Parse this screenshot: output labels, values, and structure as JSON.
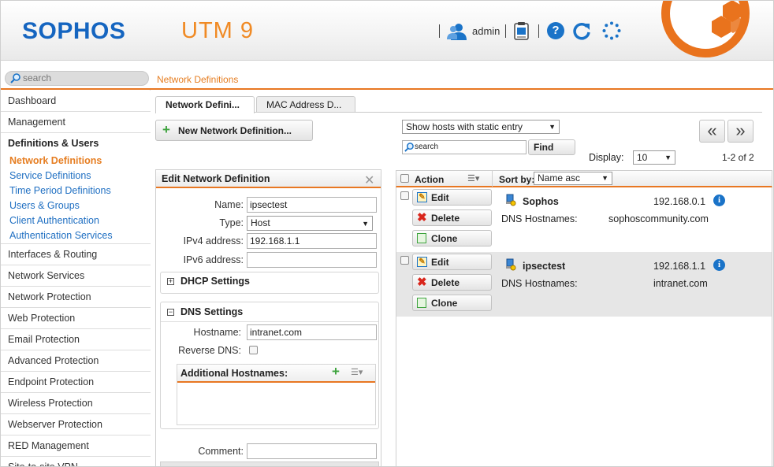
{
  "header": {
    "logo": "SOPHOS",
    "product": "UTM 9",
    "user": "admin"
  },
  "topbar": {
    "search_placeholder": "search",
    "breadcrumb": "Network Definitions"
  },
  "sidebar": {
    "items": [
      {
        "label": "Dashboard"
      },
      {
        "label": "Management"
      },
      {
        "label": "Definitions & Users"
      },
      {
        "label": "Interfaces & Routing"
      },
      {
        "label": "Network Services"
      },
      {
        "label": "Network Protection"
      },
      {
        "label": "Web Protection"
      },
      {
        "label": "Email Protection"
      },
      {
        "label": "Advanced Protection"
      },
      {
        "label": "Endpoint Protection"
      },
      {
        "label": "Wireless Protection"
      },
      {
        "label": "Webserver Protection"
      },
      {
        "label": "RED Management"
      },
      {
        "label": "Site-to-site VPN"
      }
    ],
    "subitems": [
      {
        "label": "Network Definitions"
      },
      {
        "label": "Service Definitions"
      },
      {
        "label": "Time Period Definitions"
      },
      {
        "label": "Users & Groups"
      },
      {
        "label": "Client Authentication"
      },
      {
        "label": "Authentication Services"
      }
    ]
  },
  "tabs": [
    {
      "label": "Network Defini..."
    },
    {
      "label": "MAC Address D..."
    }
  ],
  "toolbar": {
    "new_label": "New Network Definition...",
    "filter_value": "Show hosts with static entry",
    "search_placeholder": "search",
    "find_label": "Find",
    "display_label": "Display:",
    "display_value": "10",
    "count_text": "1-2 of 2",
    "prev": "«",
    "next": "»"
  },
  "edit": {
    "title": "Edit Network Definition",
    "name_label": "Name:",
    "name_value": "ipsectest",
    "type_label": "Type:",
    "type_value": "Host",
    "ipv4_label": "IPv4 address:",
    "ipv4_value": "192.168.1.1",
    "ipv6_label": "IPv6 address:",
    "ipv6_value": "",
    "dhcp_title": "DHCP Settings",
    "dns_title": "DNS Settings",
    "hostname_label": "Hostname:",
    "hostname_value": "intranet.com",
    "reverse_label": "Reverse DNS:",
    "additional_label": "Additional Hostnames:",
    "comment_label": "Comment:",
    "comment_value": ""
  },
  "list": {
    "action_label": "Action",
    "sortby_label": "Sort by:",
    "sort_value": "Name asc",
    "edit_label": "Edit",
    "delete_label": "Delete",
    "clone_label": "Clone",
    "rows": [
      {
        "name": "Sophos",
        "ip": "192.168.0.1",
        "dns_label": "DNS Hostnames:",
        "dns_value": "sophoscommunity.com"
      },
      {
        "name": "ipsectest",
        "ip": "192.168.1.1",
        "dns_label": "DNS Hostnames:",
        "dns_value": "intranet.com"
      }
    ]
  },
  "colors": {
    "accent": "#e87722",
    "brand": "#1565c0",
    "link": "#1f6fc2"
  }
}
